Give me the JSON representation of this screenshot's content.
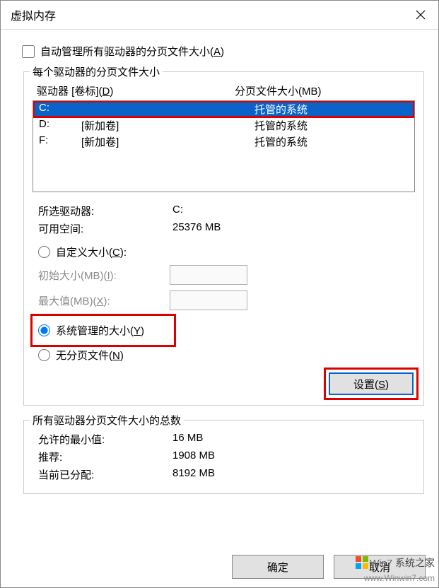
{
  "title": "虚拟内存",
  "auto_manage": {
    "label": "自动管理所有驱动器的分页文件大小(",
    "accel": "A",
    "tail": ")"
  },
  "group1": {
    "title": "每个驱动器的分页文件大小",
    "hdr_drive": "驱动器 [卷标](",
    "hdr_drive_acc": "D",
    "hdr_drive_tail": ")",
    "hdr_page": "分页文件大小(MB)",
    "rows": [
      {
        "drive": "C:",
        "label": "",
        "page": "托管的系统",
        "selected": true
      },
      {
        "drive": "D:",
        "label": "[新加卷]",
        "page": "托管的系统",
        "selected": false
      },
      {
        "drive": "F:",
        "label": "[新加卷]",
        "page": "托管的系统",
        "selected": false
      }
    ],
    "selected_drive_label": "所选驱动器:",
    "selected_drive_value": "C:",
    "free_space_label": "可用空间:",
    "free_space_value": "25376 MB",
    "custom_label": "自定义大小(",
    "custom_acc": "C",
    "custom_tail": "):",
    "init_label": "初始大小(MB)(",
    "init_acc": "I",
    "init_tail": "):",
    "max_label": "最大值(MB)(",
    "max_acc": "X",
    "max_tail": "):",
    "sys_label": "系统管理的大小(",
    "sys_acc": "Y",
    "sys_tail": ")",
    "none_label": "无分页文件(",
    "none_acc": "N",
    "none_tail": ")",
    "set_btn": "设置(",
    "set_acc": "S",
    "set_tail": ")"
  },
  "group2": {
    "title": "所有驱动器分页文件大小的总数",
    "rows": [
      {
        "label": "允许的最小值:",
        "value": "16 MB"
      },
      {
        "label": "推荐:",
        "value": "1908 MB"
      },
      {
        "label": "当前已分配:",
        "value": "8192 MB"
      }
    ]
  },
  "actions": {
    "ok": "确定",
    "cancel": "取消"
  },
  "watermark": {
    "zh": "系统之家",
    "url": "www.Winwin7.com",
    "win": "Win7"
  }
}
